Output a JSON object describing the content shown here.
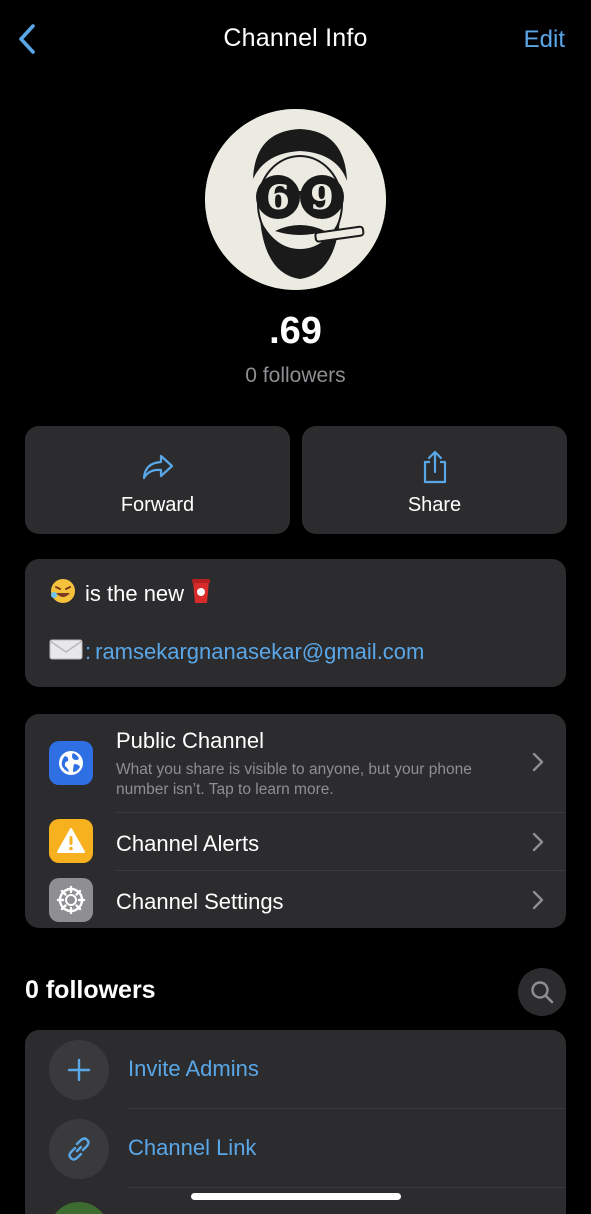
{
  "nav": {
    "title": "Channel Info",
    "edit_label": "Edit"
  },
  "channel": {
    "name": ".69",
    "followers": "0 followers",
    "avatar_text": "69"
  },
  "actions": {
    "forward_label": "Forward",
    "share_label": "Share"
  },
  "about": {
    "line1": "is the new",
    "line2_prefix": ":",
    "email": "ramsekargnanasekar@gmail.com"
  },
  "settings": {
    "public_title": "Public Channel",
    "public_sub": "What you share is visible to anyone, but your phone number isn’t. Tap to learn more.",
    "alerts_title": "Channel Alerts",
    "settings_title": "Channel Settings"
  },
  "followers_section": {
    "title": "0 followers"
  },
  "members": {
    "invite_label": "Invite Admins",
    "link_label": "Channel Link"
  },
  "colors": {
    "accent": "#5aa7e8",
    "card": "#2c2c2e",
    "public_icon": "#2f6fe4",
    "alerts_icon": "#f7b11e",
    "settings_icon": "#8e8e93"
  },
  "icons": [
    "back-chevron-icon",
    "forward-arrow-icon",
    "share-icon",
    "globe-icon",
    "warning-icon",
    "gear-icon",
    "chevron-right-icon",
    "search-icon",
    "plus-icon",
    "link-icon"
  ]
}
